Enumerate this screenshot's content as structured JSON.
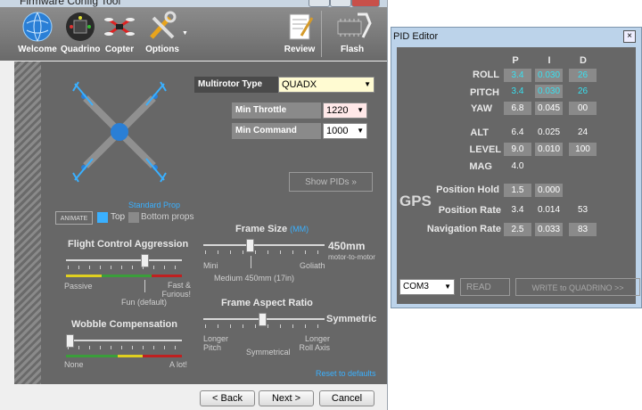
{
  "main_window": {
    "title": "Firmware Config Tool",
    "toolbar": {
      "items": [
        {
          "label": "Welcome",
          "icon": "globe-icon"
        },
        {
          "label": "Quadrino",
          "icon": "board-icon"
        },
        {
          "label": "Copter",
          "icon": "copter-icon"
        },
        {
          "label": "Options",
          "icon": "tools-icon"
        },
        {
          "label": "Review",
          "icon": "document-icon"
        },
        {
          "label": "Flash",
          "icon": "flash-chip-icon"
        }
      ]
    },
    "multirotor_type": {
      "label": "Multirotor Type",
      "value": "QUADX"
    },
    "min_throttle": {
      "label": "Min Throttle",
      "value": "1220"
    },
    "min_command": {
      "label": "Min Command",
      "value": "1000"
    },
    "show_pids_button": "Show PIDs »",
    "prop": {
      "standard_label": "Standard Prop",
      "animate_button": "ANIMATE",
      "top_label": "Top",
      "bottom_label": "Bottom props"
    },
    "flight_control": {
      "title": "Flight Control Aggression",
      "left": "Passive",
      "middle": "Fun (default)",
      "right": "Fast & Furious!"
    },
    "wobble": {
      "title": "Wobble Compensation",
      "left": "None",
      "right": "A lot!"
    },
    "frame_size": {
      "title": "Frame Size",
      "unit": "(MM)",
      "value": "450mm",
      "value_caption": "motor-to-motor",
      "left": "Mini",
      "middle": "Medium 450mm (17in)",
      "right": "Goliath"
    },
    "aspect_ratio": {
      "title": "Frame Aspect Ratio",
      "value": "Symmetric",
      "left": "Longer Pitch",
      "middle": "Symmetrical",
      "right": "Longer Roll Axis"
    },
    "reset_link": "Reset to defaults",
    "nav": {
      "back": "< Back",
      "next": "Next >",
      "cancel": "Cancel"
    }
  },
  "pid_editor": {
    "title": "PID Editor",
    "columns": [
      "P",
      "I",
      "D"
    ],
    "rows": [
      {
        "name": "ROLL",
        "p": "3.4",
        "i": "0.030",
        "d": "26"
      },
      {
        "name": "PITCH",
        "p": "3.4",
        "i": "0.030",
        "d": "26"
      },
      {
        "name": "YAW",
        "p": "6.8",
        "i": "0.045",
        "d": "00"
      },
      {
        "name": "ALT",
        "p": "6.4",
        "i": "0.025",
        "d": "24"
      },
      {
        "name": "LEVEL",
        "p": "9.0",
        "i": "0.010",
        "d": "100"
      },
      {
        "name": "MAG",
        "p": "4.0",
        "i": "",
        "d": ""
      },
      {
        "name": "Position Hold",
        "p": "1.5",
        "i": "0.000",
        "d": ""
      },
      {
        "name": "Position Rate",
        "p": "3.4",
        "i": "0.014",
        "d": "53"
      },
      {
        "name": "Navigation Rate",
        "p": "2.5",
        "i": "0.033",
        "d": "83"
      }
    ],
    "gps_label": "GPS",
    "port": "COM3",
    "read_button": "READ",
    "write_button": "WRITE to QUADRINO >>",
    "colors": {
      "highlight": "#38e0f0",
      "panel": "#676767",
      "accent": "#3ab0ff"
    }
  }
}
